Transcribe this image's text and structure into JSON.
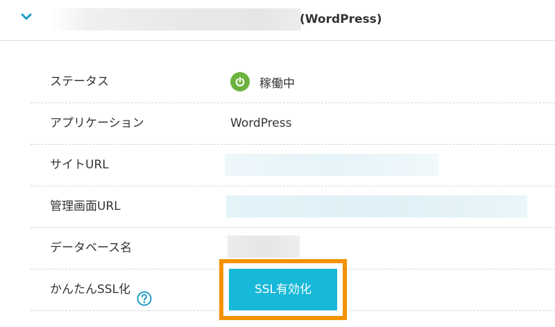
{
  "header": {
    "title_suffix": "(WordPress)",
    "chevron_icon": "chevron-down-icon",
    "accent_color": "#1e9bc8"
  },
  "rows": [
    {
      "label": "ステータス",
      "status_text": "稼働中",
      "status_icon": "power-icon",
      "status_color": "#6cb33e"
    },
    {
      "label": "アプリケーション",
      "value": "WordPress"
    },
    {
      "label": "サイトURL"
    },
    {
      "label": "管理画面URL"
    },
    {
      "label": "データベース名"
    },
    {
      "label": "かんたんSSL化",
      "help_icon": "question-circle-icon"
    }
  ],
  "ssl_button": {
    "label": "SSL有効化",
    "color": "#17b8d8",
    "highlight_color": "#f39200"
  }
}
